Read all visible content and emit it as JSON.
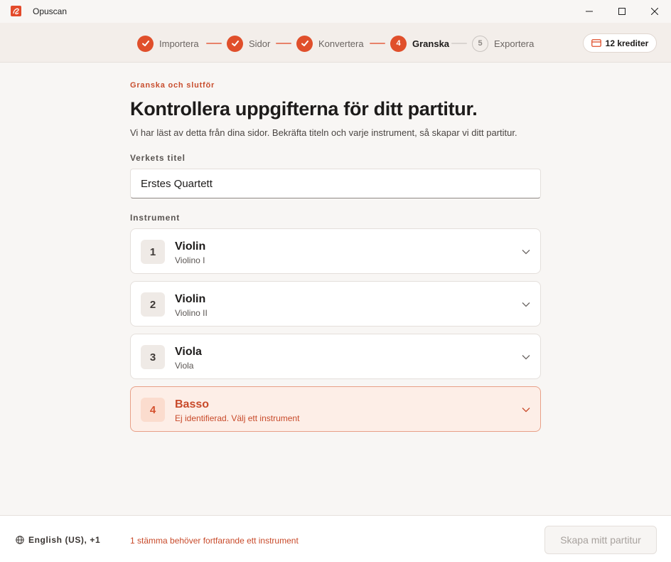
{
  "window": {
    "app_title": "Opuscan"
  },
  "stepper": {
    "steps": [
      {
        "label": "Importera",
        "state": "done"
      },
      {
        "label": "Sidor",
        "state": "done"
      },
      {
        "label": "Konvertera",
        "state": "done"
      },
      {
        "label": "Granska",
        "number": "4",
        "state": "active"
      },
      {
        "label": "Exportera",
        "number": "5",
        "state": "todo"
      }
    ],
    "credits_label": "12 krediter"
  },
  "main": {
    "eyebrow": "Granska och slutför",
    "title": "Kontrollera uppgifterna för ditt partitur.",
    "description": "Vi har läst av detta från dina sidor. Bekräfta titeln och varje instrument, så skapar vi ditt partitur.",
    "work_title_label": "Verkets titel",
    "work_title_value": "Erstes Quartett",
    "instruments_label": "Instrument",
    "instruments": [
      {
        "number": "1",
        "name": "Violin",
        "sub": "Violino I",
        "state": "ok"
      },
      {
        "number": "2",
        "name": "Violin",
        "sub": "Violino II",
        "state": "ok"
      },
      {
        "number": "3",
        "name": "Viola",
        "sub": "Viola",
        "state": "ok"
      },
      {
        "number": "4",
        "name": "Basso",
        "sub": "Ej identifierad. Välj ett instrument",
        "state": "warning"
      }
    ]
  },
  "footer": {
    "language": "English (US), +1",
    "status": "1 stämma behöver fortfarande ett instrument",
    "create_button": "Skapa mitt partitur"
  },
  "colors": {
    "accent": "#e04f2b",
    "warning_text": "#c84a2a",
    "warning_bg": "#fdeee7"
  },
  "icons": [
    "app-logo-icon",
    "minimize-icon",
    "maximize-icon",
    "close-icon",
    "check-icon",
    "credit-card-icon",
    "chevron-down-icon",
    "globe-icon"
  ]
}
